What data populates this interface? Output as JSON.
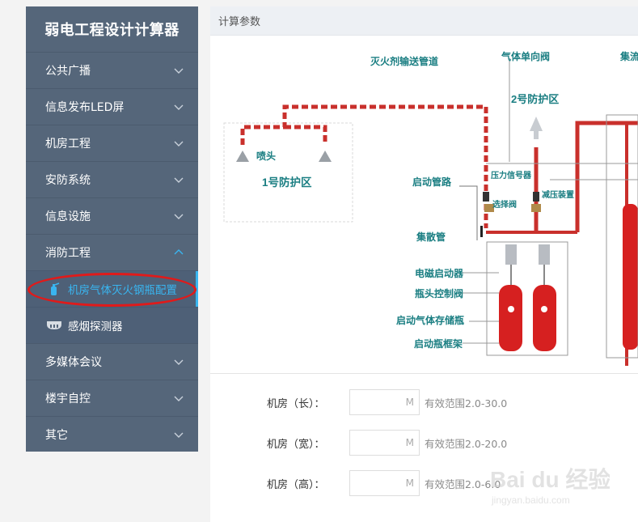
{
  "app": {
    "title": "弱电工程设计计算器"
  },
  "sidebar": {
    "items": [
      {
        "label": "公共广播"
      },
      {
        "label": "信息发布LED屏"
      },
      {
        "label": "机房工程"
      },
      {
        "label": "安防系统"
      },
      {
        "label": "信息设施"
      },
      {
        "label": "消防工程",
        "expanded": true,
        "children": [
          {
            "label": "机房气体灭火钢瓶配置",
            "active": true,
            "icon": "extinguisher-icon"
          },
          {
            "label": "感烟探测器",
            "icon": "smoke-detector-icon"
          }
        ]
      },
      {
        "label": "多媒体会议"
      },
      {
        "label": "楼宇自控"
      },
      {
        "label": "其它"
      }
    ],
    "accent": "#39b5f0",
    "highlight_color": "#e01a1a"
  },
  "panel": {
    "title": "计算参数",
    "diagram": {
      "labels": {
        "pipe": "灭火剂输送管道",
        "check_valve": "气体单向阀",
        "manifold_top": "集流",
        "zone2": "2号防护区",
        "nozzle": "喷头",
        "zone1": "1号防护区",
        "start_pipe": "启动管路",
        "pressure_switch": "压力信号器",
        "select_valve": "选择阀",
        "reducer": "减压装置",
        "collector": "集散管",
        "solenoid": "电磁启动器",
        "head_valve": "瓶头控制阀",
        "gas_cylinder": "启动气体存储瓶",
        "frame": "启动瓶框架"
      }
    },
    "form": [
      {
        "label": "机房（长）：",
        "unit": "M",
        "hint": "有效范围2.0-30.0"
      },
      {
        "label": "机房（宽）：",
        "unit": "M",
        "hint": "有效范围2.0-20.0"
      },
      {
        "label": "机房（高）：",
        "unit": "M",
        "hint": "有效范围2.0-6.0"
      }
    ]
  },
  "watermark": {
    "brand": "Bai du 经验",
    "url": "jingyan.baidu.com"
  }
}
